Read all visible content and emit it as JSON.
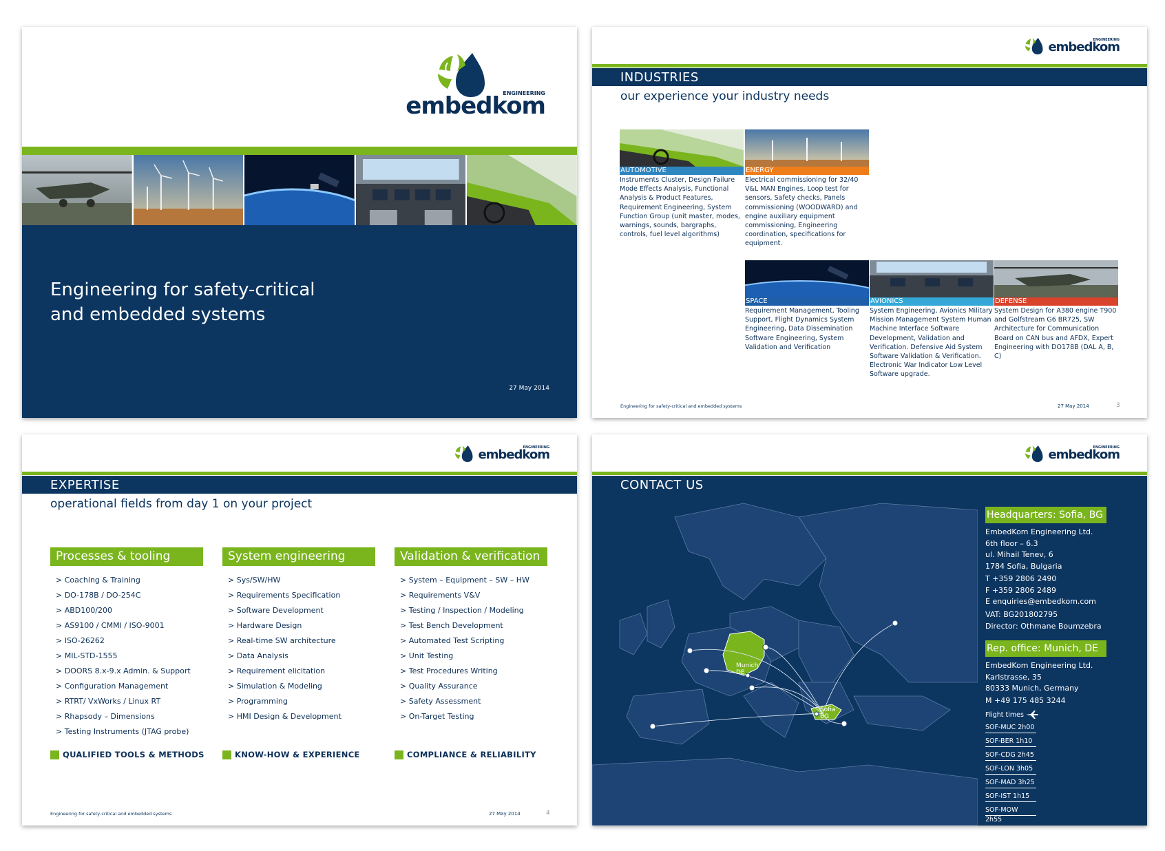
{
  "brand": {
    "name": "embedkom",
    "tag": "ENGINEERING",
    "green": "#7ab51d",
    "navy": "#0c3560"
  },
  "cover": {
    "title_line1": "Engineering for safety-critical",
    "title_line2": "and embedded systems",
    "date": "27 May 2014"
  },
  "industries": {
    "title": "INDUSTRIES",
    "subtitle": "our experience your industry needs",
    "footer": "Engineering for safety-critical and embedded systems",
    "date": "27 May 2014",
    "page": "3",
    "items": [
      {
        "label": "AUTOMOTIVE",
        "color": "#2e86c1",
        "desc": "Instruments Cluster, Design Failure Mode Effects Analysis, Functional Analysis & Product Features, Requirement Engineering, System Function Group (unit master, modes, warnings, sounds, bargraphs, controls, fuel level algorithms)"
      },
      {
        "label": "ENERGY",
        "color": "#ef7d1a",
        "desc": "Electrical commissioning for 32/40 V&L MAN Engines, Loop test for sensors, Safety checks, Panels commissioning (WOODWARD) and engine auxiliary equipment commissioning, Engineering coordination, specifications for equipment."
      },
      {
        "label": "SPACE",
        "color": "#1f5ea8",
        "desc": "Requirement Management, Tooling Support,  Flight Dynamics System Engineering, Data Dissemination Software Engineering, System Validation and Verification"
      },
      {
        "label": "AVIONICS",
        "color": "#34a9d8",
        "desc": "System Engineering, Avionics Military Mission Management System Human Machine Interface Software Development, Validation and Verification. Defensive Aid System Software Validation & Verification. Electronic War Indicator Low Level Software upgrade."
      },
      {
        "label": "DEFENSE",
        "color": "#d9432c",
        "desc": "System Design for A380 engine T900 and Golfstream G6 BR725, SW Architecture for Communication Board on CAN bus and AFDX, Expert Engineering with DO178B (DAL A, B, C)"
      }
    ]
  },
  "expertise": {
    "title": "EXPERTISE",
    "subtitle": "operational fields from day 1 on your project",
    "footer": "Engineering for safety-critical and embedded systems",
    "date": "27 May 2014",
    "page": "4",
    "columns": [
      {
        "head": "Processes & tooling",
        "tag": "QUALIFIED TOOLS & METHODS",
        "items": [
          "> Coaching & Training",
          "> DO-178B / DO-254C",
          "> ABD100/200",
          "> AS9100 / CMMI / ISO-9001",
          "> ISO-26262",
          "> MIL-STD-1555",
          "> DOORS 8.x-9.x Admin. & Support",
          "> Configuration Management",
          "> RTRT/ VxWorks / Linux RT",
          "> Rhapsody – Dimensions",
          "> Testing Instruments (JTAG probe)"
        ]
      },
      {
        "head": "System engineering",
        "tag": "KNOW-HOW & EXPERIENCE",
        "items": [
          "> Sys/SW/HW",
          "> Requirements Specification",
          "> Software Development",
          "> Hardware Design",
          "> Real-time SW architecture",
          "> Data Analysis",
          "> Requirement elicitation",
          "> Simulation & Modeling",
          "> Programming",
          "> HMI Design & Development"
        ]
      },
      {
        "head": "Validation & verification",
        "tag": "COMPLIANCE & RELIABILITY",
        "items": [
          "> System – Equipment – SW – HW",
          "> Requirements V&V",
          "> Testing / Inspection / Modeling",
          "> Test Bench Development",
          "> Automated Test Scripting",
          "> Unit Testing",
          "> Test Procedures Writing",
          "> Quality Assurance",
          "> Safety Assessment",
          "> On-Target Testing"
        ]
      }
    ]
  },
  "contact": {
    "title": "CONTACT US",
    "hq_title": "Headquarters: Sofia, BG",
    "hq_address": "EmbedKom Engineering Ltd.\n6th floor – 6.3\nul. Mihail Tenev, 6\n1784 Sofia, Bulgaria",
    "hq_phones": "T +359 2806 2490\nF +359 2806 2489\nE enquiries@embedkom.com",
    "hq_reg": "VAT: BG201802795\nDirector: Othmane Boumzebra",
    "rep_title": "Rep. office: Munich, DE",
    "rep_address": "EmbedKom Engineering Ltd.\nKarlstrasse, 35\n80333 Munich, Germany",
    "rep_phone": "M +49 175 485 3244",
    "flight_label": "Flight times",
    "flights": [
      "SOF-MUC 2h00",
      "SOF-BER 1h10",
      "SOF-CDG 2h45",
      "SOF-LON 3h05",
      "SOF-MAD 3h25",
      "SOF-IST 1h15",
      "SOF-MOW 2h55"
    ],
    "map_de": "Munich",
    "map_de2": "DE",
    "map_bg": "Sofia",
    "map_bg2": "BG"
  }
}
